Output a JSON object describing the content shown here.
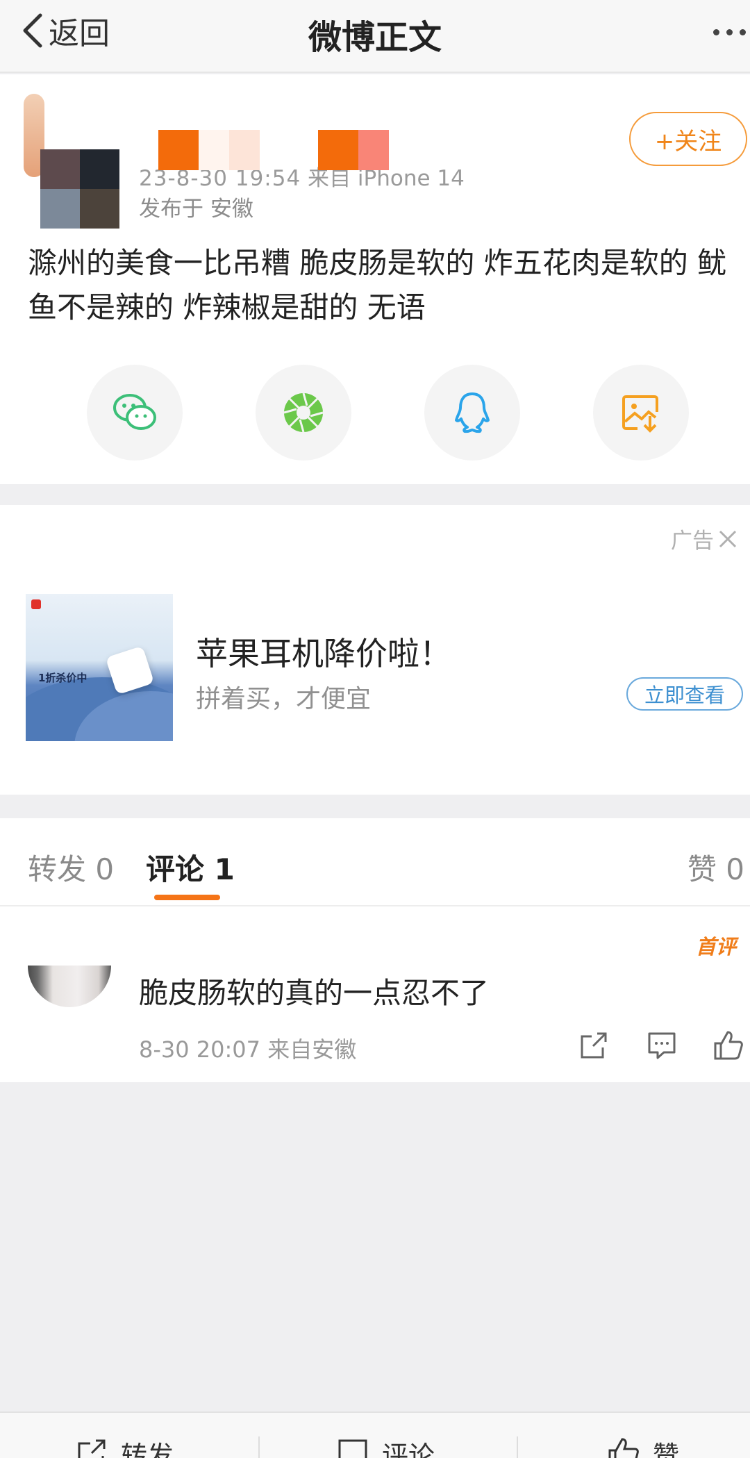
{
  "nav": {
    "back_label": "返回",
    "title": "微博正文"
  },
  "post": {
    "timestamp": "23-8-30 19:54",
    "source": "来自 iPhone 14",
    "location": "发布于 安徽",
    "follow_label": "+关注",
    "text": "滁州的美食一比吊糟 脆皮肠是软的 炸五花肉是软的 鱿鱼不是辣的 炸辣椒是甜的  无语",
    "share_icons": [
      "wechat-icon",
      "moments-icon",
      "qq-icon",
      "save-image-icon"
    ],
    "name_redaction_colors": [
      "#f36b0b",
      "#fff4ee",
      "#fde4d8",
      "#f36b0b",
      "#f98577"
    ]
  },
  "ad": {
    "tag": "广告",
    "image_promo": "1折杀价中",
    "title": "苹果耳机降价啦！",
    "subtitle": "拼着买，才便宜",
    "button": "立即查看"
  },
  "comments": {
    "tabs": [
      {
        "label": "转发 0"
      },
      {
        "label": "评论 1"
      },
      {
        "label": "赞 0"
      }
    ],
    "first_badge": "首评",
    "items": [
      {
        "text": "脆皮肠软的真的一点忍不了",
        "time": "8-30 20:07",
        "source": "来自安徽"
      }
    ]
  },
  "bottom_bar": {
    "repost": "转发",
    "comment": "评论",
    "like": "赞"
  },
  "colors": {
    "accent": "#f57417",
    "link": "#3c8fd0",
    "page_bg": "#efeff1"
  }
}
